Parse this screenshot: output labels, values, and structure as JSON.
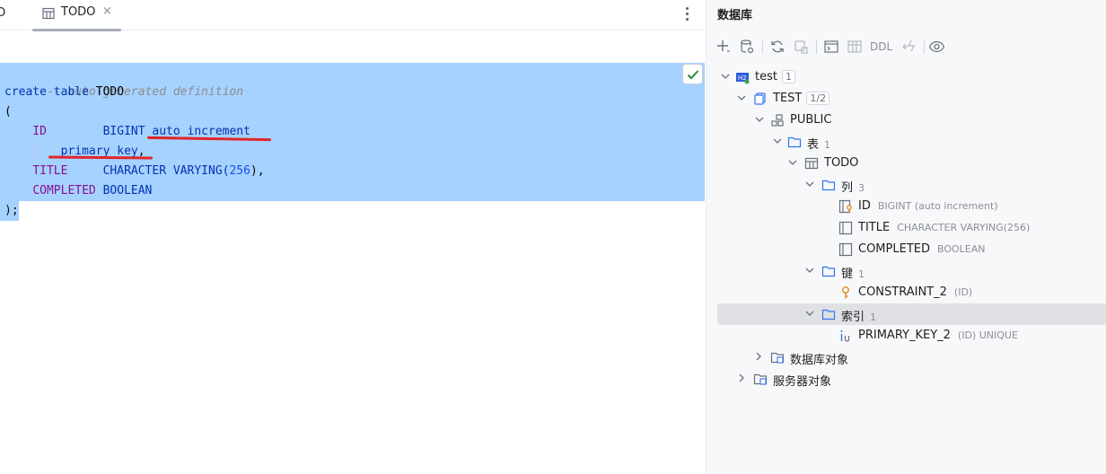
{
  "tabs": {
    "prev_tab_fragment": "O",
    "active_tab": {
      "label": "TODO",
      "close": "×",
      "icon": "table-icon"
    }
  },
  "editor": {
    "lines": [
      {
        "comment": "-- auto-generated definition"
      },
      {
        "kw_create": "create",
        "kw_table": "table",
        "name": "TODO"
      },
      {
        "open": "("
      },
      {
        "col": "ID",
        "type": "BIGINT",
        "extra": " auto_increment"
      },
      {
        "extra": "primary key",
        "trail": ","
      },
      {
        "col": "TITLE",
        "type": "CHARACTER VARYING(",
        "num": "256",
        "close": "),",
        "trail": ""
      },
      {
        "col": "COMPLETED",
        "type": "BOOLEAN"
      },
      {
        "close": ");"
      }
    ],
    "inspection_status": "check-icon"
  },
  "panel": {
    "title": "数据库",
    "toolbar": {
      "items": [
        "add-icon",
        "datasource-properties-icon",
        "refresh-icon",
        "stop-icon",
        "console-icon",
        "table-editor-icon",
        "ddl-label",
        "diff-icon",
        "view-options-icon"
      ],
      "ddl_label": "DDL"
    },
    "tree": {
      "datasource": {
        "label": "test",
        "count": "1"
      },
      "database": {
        "label": "TEST",
        "count": "1/2"
      },
      "schema": {
        "label": "PUBLIC"
      },
      "tables_folder": {
        "label": "表",
        "count": "1"
      },
      "table": {
        "label": "TODO"
      },
      "columns_folder": {
        "label": "列",
        "count": "3"
      },
      "columns": [
        {
          "name": "ID",
          "type": "BIGINT (auto increment)"
        },
        {
          "name": "TITLE",
          "type": "CHARACTER VARYING(256)"
        },
        {
          "name": "COMPLETED",
          "type": "BOOLEAN"
        }
      ],
      "keys_folder": {
        "label": "键",
        "count": "1"
      },
      "key": {
        "name": "CONSTRAINT_2",
        "hint": "(ID)"
      },
      "indexes_folder": {
        "label": "索引",
        "count": "1"
      },
      "index": {
        "name": "PRIMARY_KEY_2",
        "hint": "(ID) UNIQUE"
      },
      "db_objects": {
        "label": "数据库对象"
      },
      "server_objects": {
        "label": "服务器对象"
      }
    }
  },
  "colors": {
    "selection": "#a6d2ff",
    "keyword": "#0033b3",
    "column": "#871094",
    "number": "#1750eb",
    "comment": "#8c8c8c",
    "annotation_red": "#e0262b",
    "accent_blue": "#3574f0"
  }
}
